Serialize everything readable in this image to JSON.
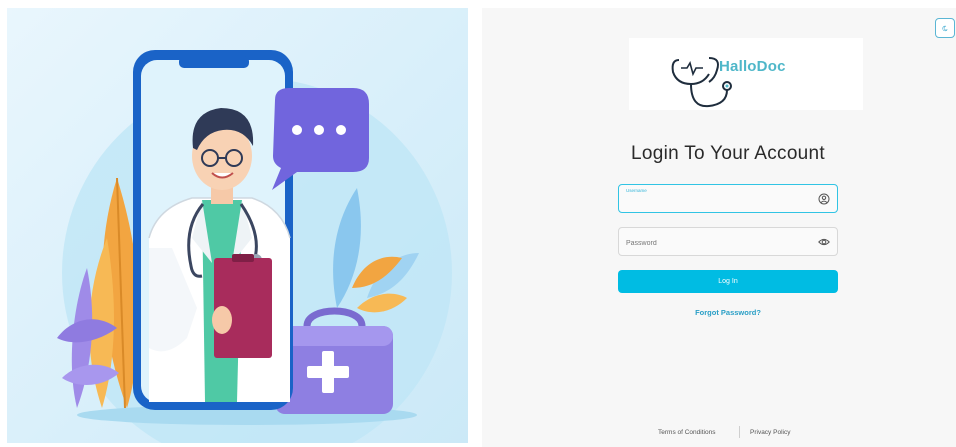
{
  "app": {
    "name": "HalloDoc"
  },
  "login": {
    "title": "Login To Your Account",
    "username_label": "Username",
    "username_value": "",
    "password_placeholder": "Password",
    "submit_label": "Log In",
    "forgot_label": "Forgot Password?"
  },
  "footer": {
    "terms_label": "Terms of Conditions",
    "privacy_label": "Privacy Policy"
  },
  "icons": {
    "theme_toggle": "moon-icon",
    "username": "user-circle-icon",
    "password": "eye-icon"
  },
  "colors": {
    "accent": "#00bce3",
    "brand_text": "#4fb7c9",
    "link": "#2a9fc6"
  }
}
